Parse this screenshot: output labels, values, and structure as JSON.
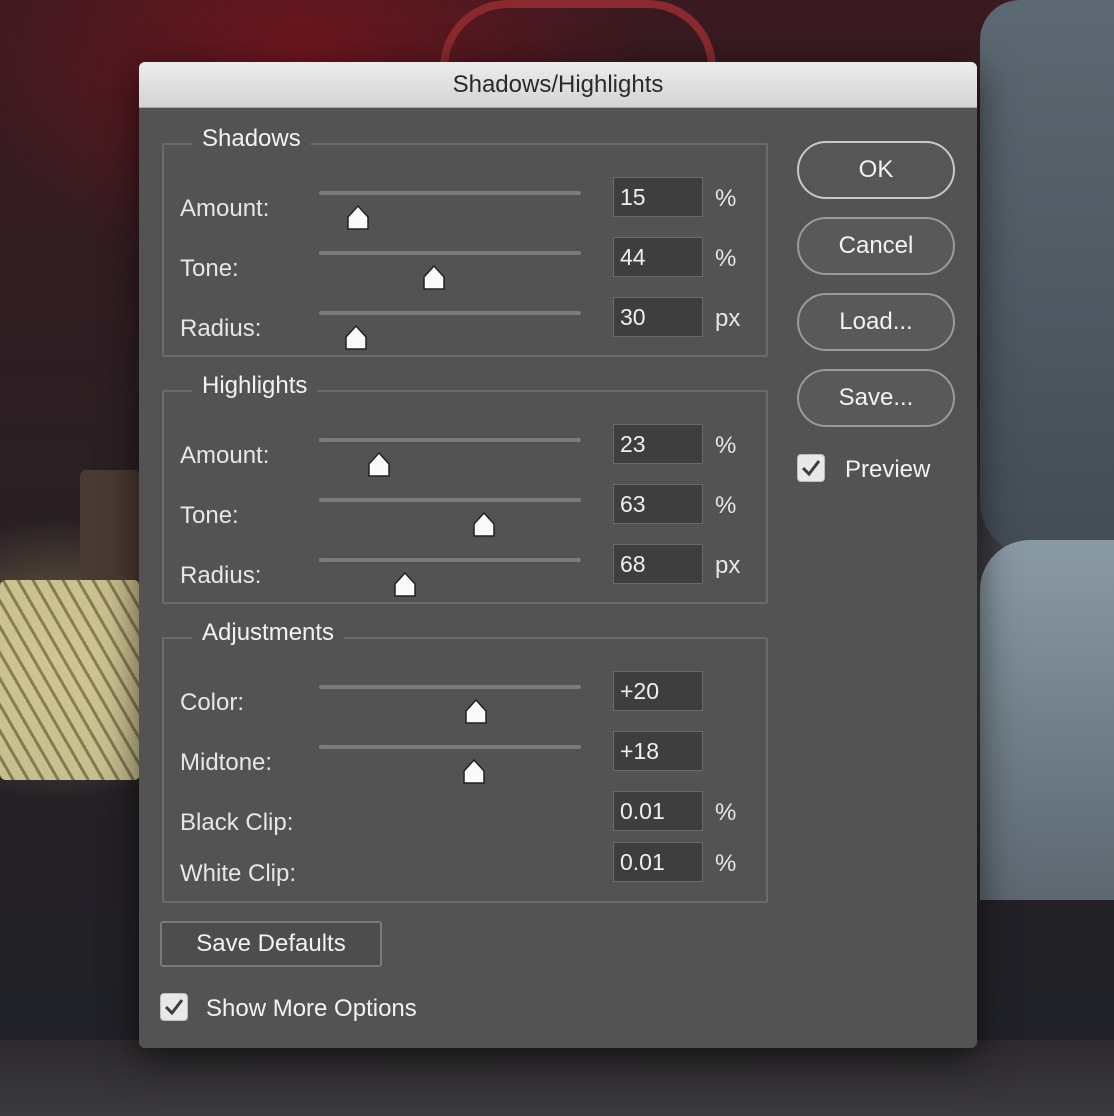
{
  "dialog": {
    "title": "Shadows/Highlights",
    "shadows": {
      "title": "Shadows",
      "rows": [
        {
          "label": "Amount:",
          "value": "15",
          "unit": "%",
          "slider": 0.15
        },
        {
          "label": "Tone:",
          "value": "44",
          "unit": "%",
          "slider": 0.44
        },
        {
          "label": "Radius:",
          "value": "30",
          "unit": "px",
          "slider": 0.14
        }
      ]
    },
    "highlights": {
      "title": "Highlights",
      "rows": [
        {
          "label": "Amount:",
          "value": "23",
          "unit": "%",
          "slider": 0.23
        },
        {
          "label": "Tone:",
          "value": "63",
          "unit": "%",
          "slider": 0.63
        },
        {
          "label": "Radius:",
          "value": "68",
          "unit": "px",
          "slider": 0.33
        }
      ]
    },
    "adjustments": {
      "title": "Adjustments",
      "rows": [
        {
          "label": "Color:",
          "value": "+20",
          "unit": "",
          "slider": 0.6
        },
        {
          "label": "Midtone:",
          "value": "+18",
          "unit": "",
          "slider": 0.59
        },
        {
          "label": "Black Clip:",
          "value": "0.01",
          "unit": "%"
        },
        {
          "label": "White Clip:",
          "value": "0.01",
          "unit": "%"
        }
      ]
    },
    "buttons": {
      "ok": "OK",
      "cancel": "Cancel",
      "load": "Load...",
      "save": "Save..."
    },
    "preview": {
      "label": "Preview",
      "checked": true
    },
    "save_defaults": "Save Defaults",
    "show_more": {
      "label": "Show More Options",
      "checked": true
    }
  }
}
